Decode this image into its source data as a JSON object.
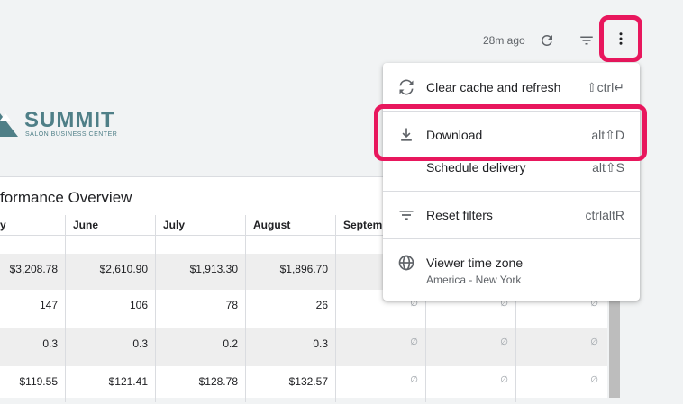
{
  "toolbar": {
    "last_updated": "28m ago",
    "icons": [
      "refresh-icon",
      "filter-icon",
      "more-vert-icon"
    ]
  },
  "logo": {
    "name": "SUMMIT",
    "subtitle": "SALON BUSINESS CENTER"
  },
  "report": {
    "title": "formance Overview",
    "columns": [
      "y",
      "June",
      "July",
      "August",
      "Septem"
    ],
    "rows": [
      [
        "",
        "",
        "",
        "",
        ""
      ],
      [
        "$3,208.78",
        "$2,610.90",
        "$1,913.30",
        "$1,896.70",
        ""
      ],
      [
        "147",
        "106",
        "78",
        "26",
        "∅"
      ],
      [
        "0.3",
        "0.3",
        "0.2",
        "0.3",
        "∅"
      ],
      [
        "$119.55",
        "$121.41",
        "$128.78",
        "$132.57",
        "∅"
      ]
    ],
    "null_glyph": "∅"
  },
  "menu": {
    "items": [
      {
        "label": "Clear cache and refresh",
        "shortcut": "⇧ctrl↵",
        "icon": "sync-icon"
      },
      {
        "label": "Download",
        "shortcut": "alt⇧D",
        "icon": "download-icon"
      },
      {
        "label": "Schedule delivery",
        "shortcut": "alt⇧S",
        "icon": ""
      },
      {
        "label": "Reset filters",
        "shortcut": "ctrlaltR",
        "icon": "filter-icon"
      },
      {
        "label": "Viewer time zone",
        "sublabel": "America - New York",
        "icon": "globe-icon"
      }
    ]
  },
  "colors": {
    "highlight": "#e8175d",
    "brand": "#4f7f87",
    "background": "#f1f3f4"
  }
}
